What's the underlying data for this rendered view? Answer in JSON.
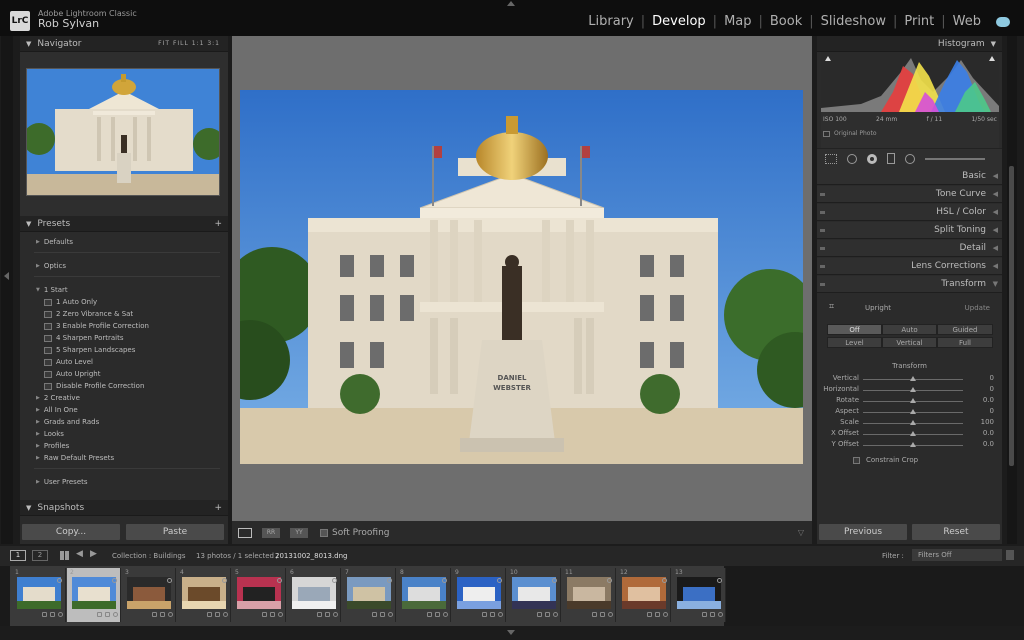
{
  "app": {
    "name": "Adobe Lightroom Classic",
    "logo": "LrC",
    "user": "Rob Sylvan"
  },
  "modules": [
    {
      "label": "Library",
      "active": false
    },
    {
      "label": "Develop",
      "active": true
    },
    {
      "label": "Map",
      "active": false
    },
    {
      "label": "Book",
      "active": false
    },
    {
      "label": "Slideshow",
      "active": false
    },
    {
      "label": "Print",
      "active": false
    },
    {
      "label": "Web",
      "active": false
    }
  ],
  "navigator": {
    "title": "Navigator",
    "zoom_options": "FIT  FILL  1:1  3:1"
  },
  "presets": {
    "title": "Presets",
    "add_label": "+",
    "groups": [
      {
        "label": "Defaults"
      },
      {
        "label": "Optics"
      },
      {
        "label": "1 Start"
      },
      {
        "label": "2 Creative"
      },
      {
        "label": "All In One"
      },
      {
        "label": "Grads and Rads"
      },
      {
        "label": "Looks"
      },
      {
        "label": "Profiles"
      },
      {
        "label": "Raw Default Presets"
      },
      {
        "label": "User Presets"
      }
    ],
    "start_items": [
      "1 Auto Only",
      "2 Zero Vibrance & Sat",
      "3 Enable Profile Correction",
      "4 Sharpen Portraits",
      "5 Sharpen Landscapes",
      "Auto Level",
      "Auto Upright",
      "Disable Profile Correction"
    ]
  },
  "snapshots": {
    "title": "Snapshots",
    "add_label": "+"
  },
  "left_buttons": {
    "copy": "Copy...",
    "paste": "Paste"
  },
  "toolbar": {
    "soft_proofing": "Soft Proofing"
  },
  "histogram": {
    "title": "Histogram",
    "iso": "ISO 100",
    "focal": "24 mm",
    "aperture": "f / 11",
    "shutter": "1/50 sec",
    "original_photo": "Original Photo"
  },
  "right_sections": [
    "Basic",
    "Tone Curve",
    "HSL / Color",
    "Split Toning",
    "Detail",
    "Lens Corrections",
    "Transform"
  ],
  "transform": {
    "upright_label": "Upright",
    "update_label": "Update",
    "buttons_row1": [
      "Off",
      "Auto",
      "Guided"
    ],
    "buttons_row2": [
      "Level",
      "Vertical",
      "Full"
    ],
    "selected": "Off",
    "subtitle": "Transform",
    "sliders": [
      {
        "label": "Vertical",
        "value": "0"
      },
      {
        "label": "Horizontal",
        "value": "0"
      },
      {
        "label": "Rotate",
        "value": "0.0"
      },
      {
        "label": "Aspect",
        "value": "0"
      },
      {
        "label": "Scale",
        "value": "100"
      },
      {
        "label": "X Offset",
        "value": "0.0"
      },
      {
        "label": "Y Offset",
        "value": "0.0"
      }
    ],
    "constrain_crop": "Constrain Crop"
  },
  "right_buttons": {
    "previous": "Previous",
    "reset": "Reset"
  },
  "filmbar": {
    "view1": "1",
    "view2": "2",
    "collection": "Collection : Buildings",
    "count": "13 photos / 1 selected /",
    "filename": "20131002_8013.dng",
    "filter_label": "Filter :",
    "filter_value": "Filters Off"
  },
  "filmstrip": [
    {
      "num": "1"
    },
    {
      "num": "2"
    },
    {
      "num": "3"
    },
    {
      "num": "4"
    },
    {
      "num": "5"
    },
    {
      "num": "6"
    },
    {
      "num": "7"
    },
    {
      "num": "8"
    },
    {
      "num": "9"
    },
    {
      "num": "10"
    },
    {
      "num": "11"
    },
    {
      "num": "12"
    },
    {
      "num": "13"
    }
  ],
  "colors": {
    "accent": "#ffffff",
    "panel": "#2b2b2b",
    "sky": "#3f7fd0"
  }
}
